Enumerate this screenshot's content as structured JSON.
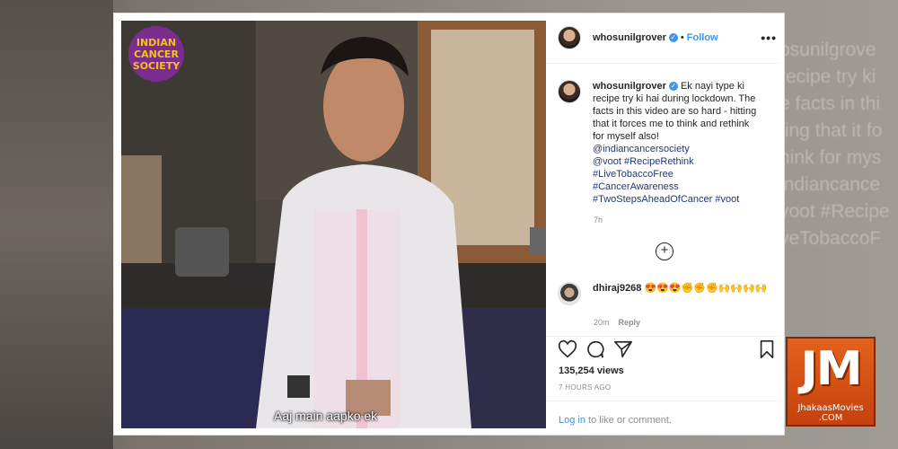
{
  "post": {
    "username": "whosunilgrover",
    "follow_label": "Follow",
    "separator": "•",
    "more_label": "•••"
  },
  "media": {
    "logo_lines": [
      "INDIAN",
      "CANCER",
      "SOCIETY"
    ],
    "subtitle": "Aaj main aapko ek"
  },
  "caption": {
    "username": "whosunilgrover",
    "text": "Ek nayi type ki recipe try ki hai during lockdown. The facts in this video are so hard - hitting that it forces me to think and rethink for myself also!",
    "links": [
      "@indiancancersociety",
      "@voot #RecipeRethink",
      "#LiveTobaccoFree",
      "#CancerAwareness",
      "#TwoStepsAheadOfCancer #voot"
    ],
    "time": "7h"
  },
  "comment": {
    "username": "dhiraj9268",
    "text": "😍😍😍✊✊✊🙌🙌🙌🙌",
    "time": "20m",
    "reply_label": "Reply"
  },
  "stats": {
    "views": "135,254 views",
    "posted": "7 HOURS AGO"
  },
  "login": {
    "link": "Log in",
    "rest": " to like or comment."
  },
  "backdrop_text": [
    "osunilgrove",
    "recipe try ki",
    "e facts in thi",
    "ting that it fo",
    "hink for mys",
    "indiancance",
    "voot #Recipe",
    "veTobaccoF"
  ],
  "watermark": {
    "big": "JM",
    "line1": "JhakaasMovies",
    "line2": ".COM"
  },
  "colors": {
    "accent": "#3897f0",
    "hashtag": "#1f3a6e",
    "watermark": "#d9531a"
  }
}
